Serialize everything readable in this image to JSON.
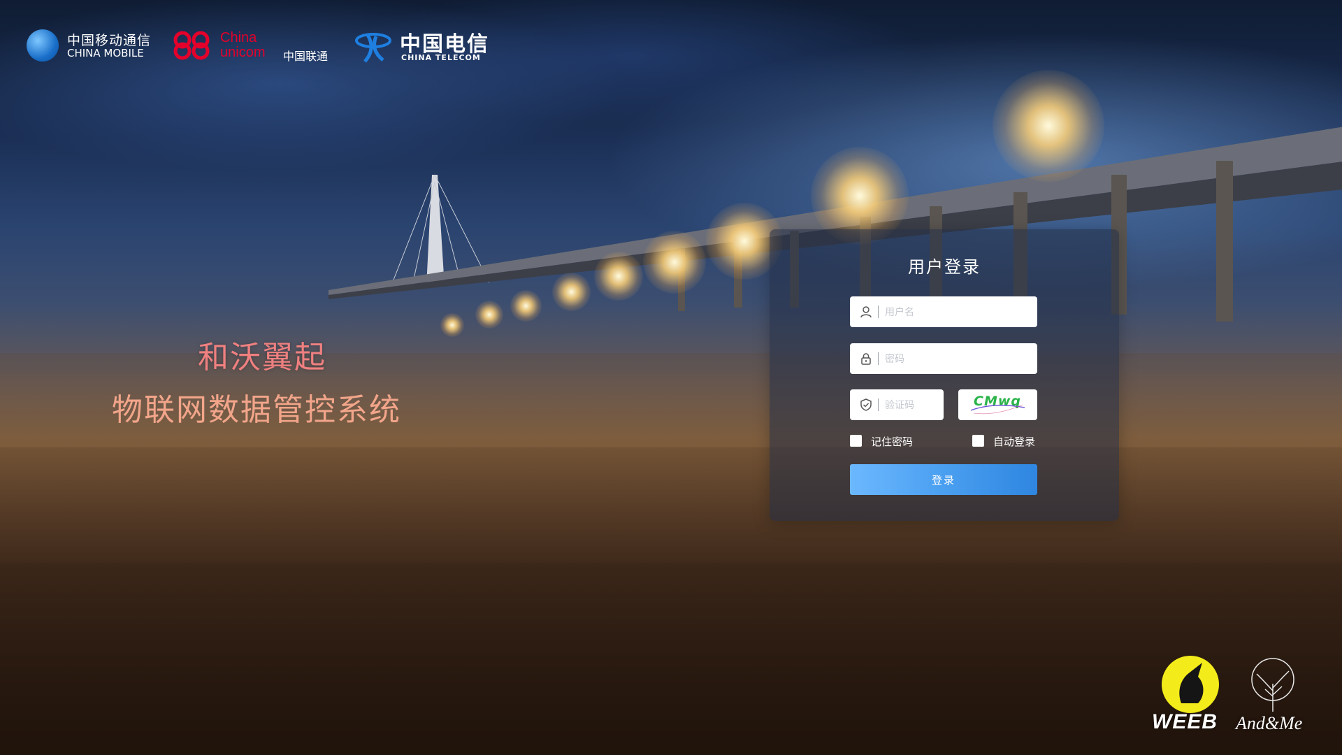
{
  "logos": {
    "china_mobile": {
      "cn": "中国移动通信",
      "en": "CHINA MOBILE",
      "color": "#1a6fc9"
    },
    "china_unicom": {
      "line1": "China",
      "line2": "unicom",
      "cn": "中国联通",
      "color": "#e4002b"
    },
    "china_telecom": {
      "cn": "中国电信",
      "en": "CHINA TELECOM",
      "color": "#0a6fd0"
    }
  },
  "headline": {
    "line1": "和沃翼起",
    "line2": "物联网数据管控系统"
  },
  "login": {
    "title": "用户登录",
    "username_placeholder": "用户名",
    "password_placeholder": "密码",
    "captcha_placeholder": "验证码",
    "captcha_text": "CMwq",
    "remember_label": "记住密码",
    "auto_login_label": "自动登录",
    "submit_label": "登录",
    "button_color": "#4a9ff0"
  },
  "brands": {
    "weeb": "WEEB",
    "andme": "And&Me"
  }
}
